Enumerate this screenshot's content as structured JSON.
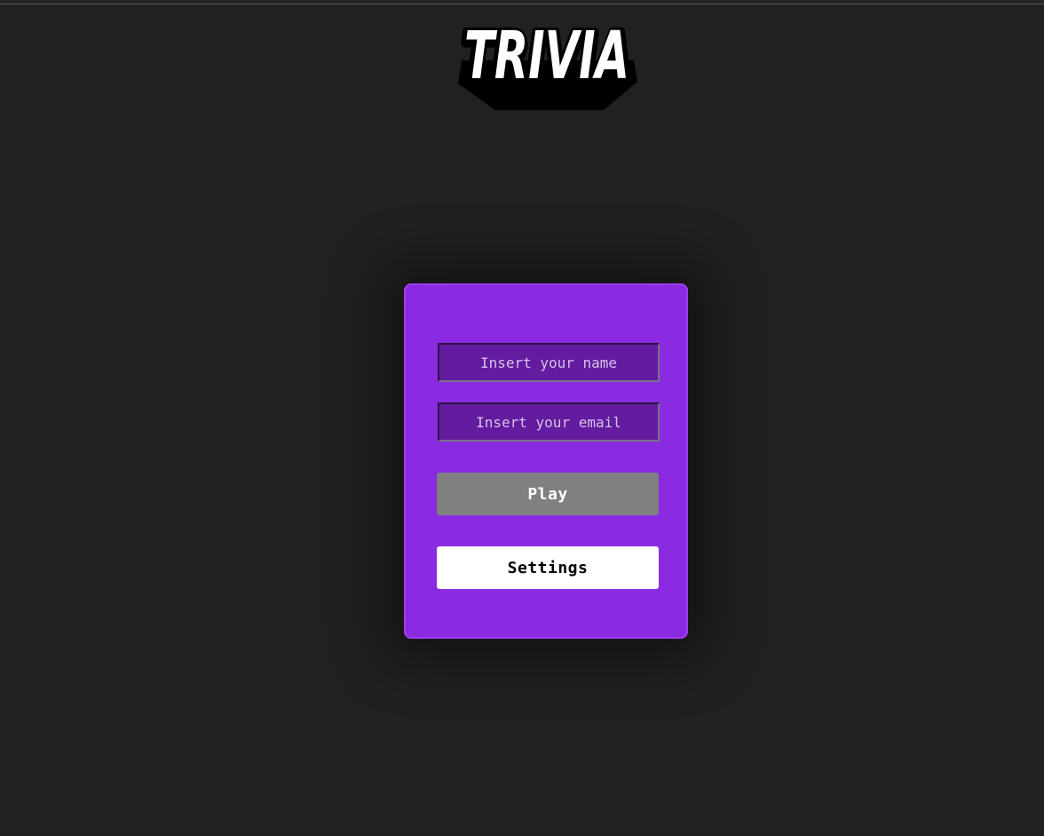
{
  "logo": {
    "text": "TRIVIA"
  },
  "form": {
    "name_placeholder": "Insert your name",
    "email_placeholder": "Insert your email"
  },
  "buttons": {
    "play_label": "Play",
    "settings_label": "Settings"
  },
  "colors": {
    "background": "#212121",
    "card": "#8a2be2",
    "input": "#631b9f",
    "play_button_disabled": "#808080",
    "settings_button": "#ffffff"
  }
}
